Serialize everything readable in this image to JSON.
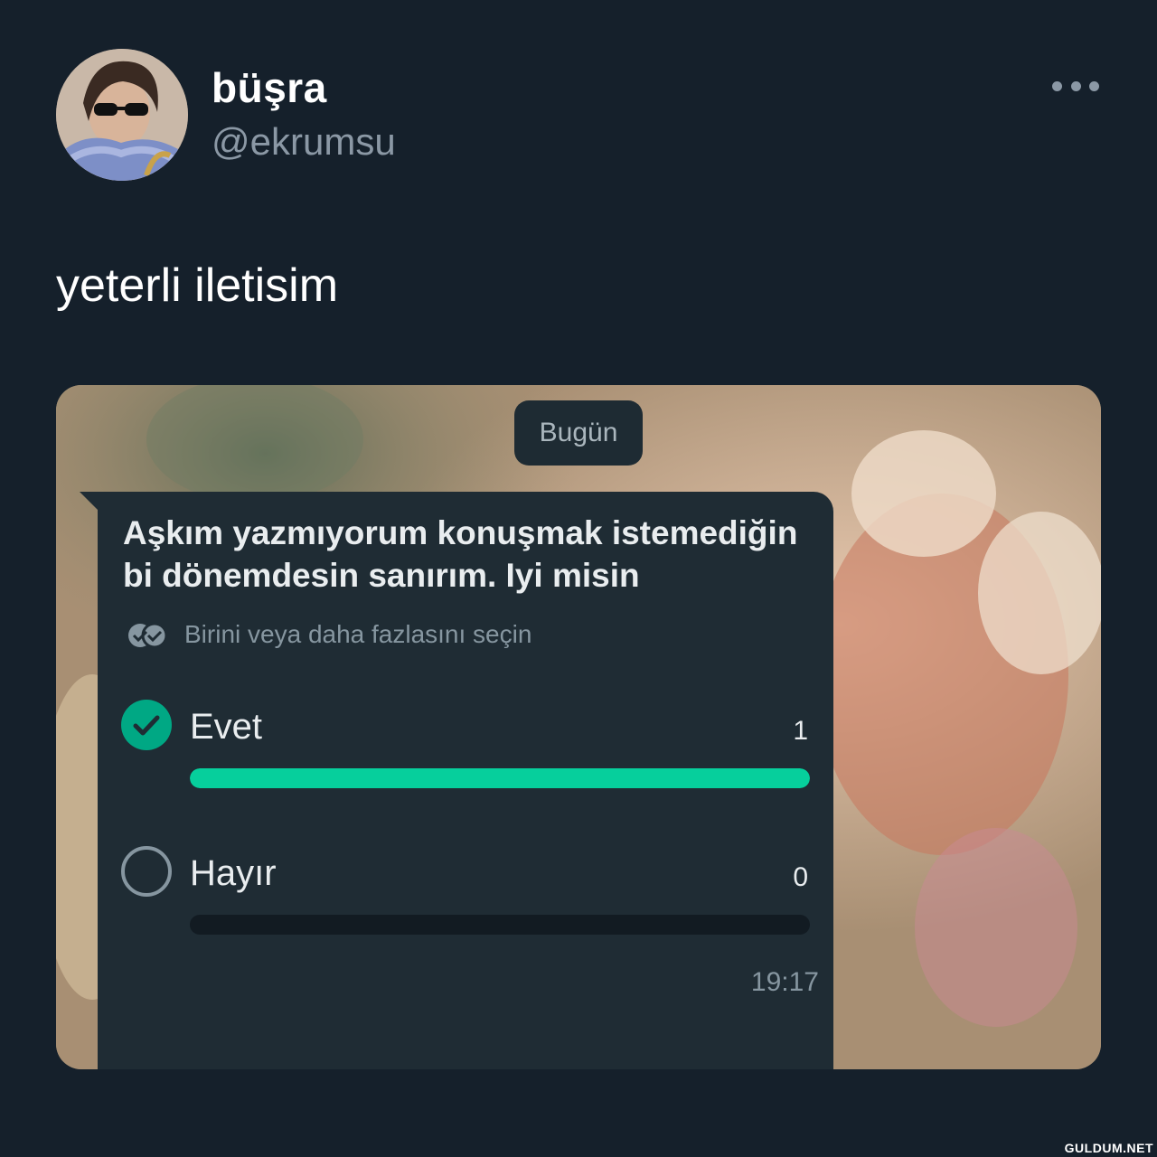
{
  "author": {
    "display_name": "büşra",
    "handle": "@ekrumsu"
  },
  "tweet": {
    "text": "yeterli iletisim"
  },
  "icons": {
    "more": "more-horizontal-icon",
    "multi_select": "double-check-icon",
    "selected": "check-circle-icon",
    "unselected": "empty-circle-icon"
  },
  "chat": {
    "date_chip": "Bugün",
    "poll": {
      "question": "Aşkım yazmıyorum konuşmak istemediğin bi dönemdesin sanırım.  Iyi misin",
      "hint": "Birini veya daha fazlasını seçin",
      "options": [
        {
          "label": "Evet",
          "votes": "1",
          "selected": true,
          "share": 1.0
        },
        {
          "label": "Hayır",
          "votes": "0",
          "selected": false,
          "share": 0.0
        }
      ],
      "time": "19:17"
    }
  },
  "colors": {
    "background": "#15202b",
    "bubble": "#1f2c34",
    "accent": "#00a884",
    "bar": "#06cf9c",
    "muted": "#8696a0"
  },
  "watermark": "GULDUM.NET"
}
